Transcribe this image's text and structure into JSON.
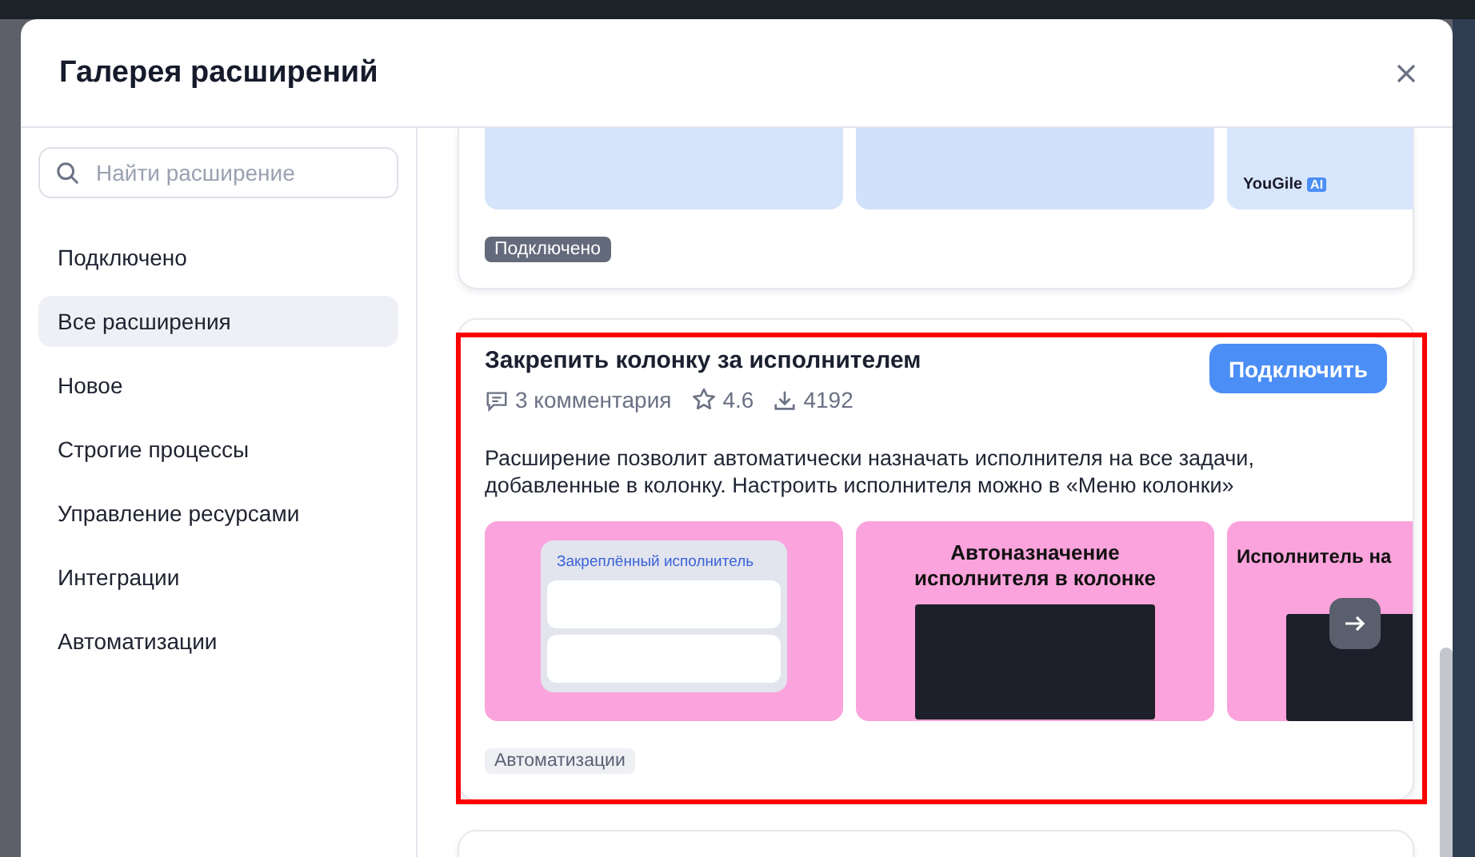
{
  "dialog": {
    "title": "Галерея расширений"
  },
  "search": {
    "placeholder": "Найти расширение"
  },
  "sidebar": {
    "items": [
      {
        "label": "Подключено",
        "selected": false
      },
      {
        "label": "Все расширения",
        "selected": true
      },
      {
        "label": "Новое",
        "selected": false
      },
      {
        "label": "Строгие процессы",
        "selected": false
      },
      {
        "label": "Управление ресурсами",
        "selected": false
      },
      {
        "label": "Интеграции",
        "selected": false
      },
      {
        "label": "Автоматизации",
        "selected": false
      }
    ]
  },
  "extensions": [
    {
      "kind": "clipped",
      "highlighted": false,
      "tag": "Подключено",
      "tag_dark": true,
      "slides": [
        {
          "kind": "chat"
        },
        {
          "kind": "board"
        },
        {
          "kind": "brand",
          "text": "YouGile",
          "badge": "AI"
        }
      ]
    },
    {
      "kind": "full",
      "highlighted": true,
      "title": "Закрепить колонку за исполнителем",
      "button": "Подключить",
      "comments": "3 комментария",
      "rating": "4.6",
      "downloads": "4192",
      "description": "Расширение позволит автоматически назначать исполнителя на все задачи, добавленные в колонку. Настроить исполнителя можно в «Меню колонки»",
      "tag": "Автоматизации",
      "tag_dark": false,
      "slides": [
        {
          "kind": "assignee",
          "text": "Закреплённый исполнитель"
        },
        {
          "kind": "headline",
          "text": "Автоназначение исполнителя в колонке"
        },
        {
          "kind": "headline-cut",
          "text": "Исполнитель на"
        }
      ]
    },
    {
      "kind": "stub",
      "highlighted": false
    }
  ]
}
